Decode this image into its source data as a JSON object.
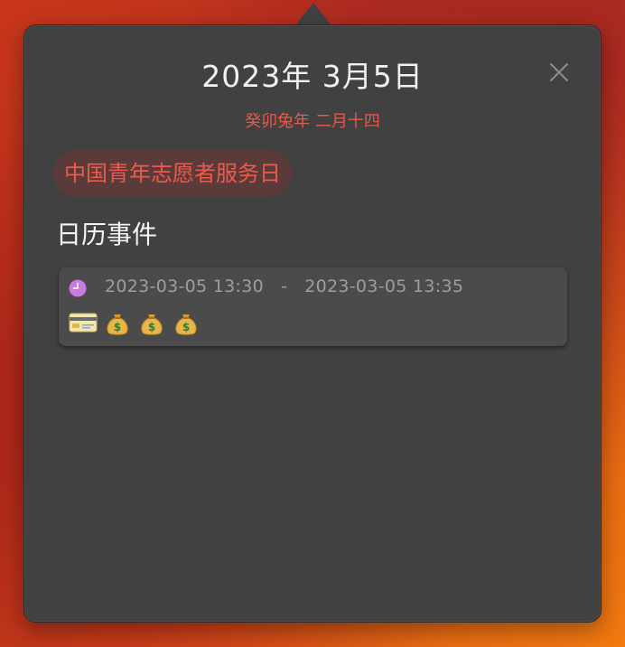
{
  "popover": {
    "title": "2023年 3月5日",
    "lunar": "癸卯兔年 二月十四",
    "holiday": "中国青年志愿者服务日",
    "section_title": "日历事件"
  },
  "event": {
    "time_range": "2023-03-05 13:30   -   2023-03-05 13:35",
    "emojis": [
      "credit-card-icon",
      "money-bag-icon",
      "money-bag-icon",
      "money-bag-icon"
    ]
  },
  "colors": {
    "panel_bg": "#414141",
    "lunar_text": "#e8584a",
    "holiday_pill_bg": "#5b3b3a",
    "clock_accent": "#c77be0"
  }
}
